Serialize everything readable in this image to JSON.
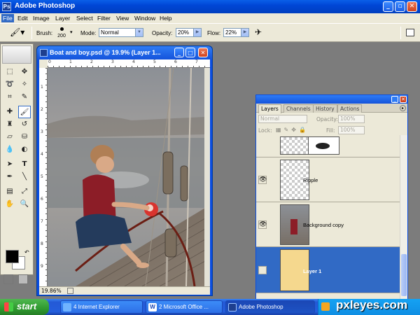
{
  "window": {
    "title": "Adobe Photoshop"
  },
  "menu": [
    "File",
    "Edit",
    "Image",
    "Layer",
    "Select",
    "Filter",
    "View",
    "Window",
    "Help"
  ],
  "options": {
    "brush_label": "Brush:",
    "brush_size": "200",
    "mode_label": "Mode:",
    "mode_value": "Normal",
    "opacity_label": "Opacity:",
    "opacity_value": "20%",
    "flow_label": "Flow:",
    "flow_value": "22%"
  },
  "document": {
    "title": "Boat and boy.psd @ 19.9% (Layer 1...",
    "zoom": "19.86%",
    "ruler_h": [
      "0",
      "1",
      "2",
      "3",
      "4",
      "5",
      "6",
      "7"
    ],
    "ruler_v": [
      "1",
      "2",
      "3",
      "4",
      "5",
      "6",
      "7",
      "8",
      "9"
    ]
  },
  "layers_palette": {
    "tabs": [
      "Layers",
      "Channels",
      "History",
      "Actions"
    ],
    "blend_mode": "Normal",
    "opacity_label": "Opacity:",
    "opacity_value": "100%",
    "lock_label": "Lock:",
    "fill_label": "Fill:",
    "fill_value": "100%",
    "layers": [
      {
        "name": "",
        "visible": false
      },
      {
        "name": "Ripple",
        "visible": true
      },
      {
        "name": "Background copy",
        "visible": true
      },
      {
        "name": "Layer 1",
        "visible": false,
        "selected": true
      }
    ]
  },
  "taskbar": {
    "start": "start",
    "items": [
      "4 Internet Explorer",
      "2 Microsoft Office ...",
      "Adobe Photoshop"
    ]
  },
  "watermark": "pxleyes.com",
  "colors": {
    "xp_blue": "#0046d6",
    "selected_layer": "#316ac5",
    "layer1_fill": "#f5d88e",
    "start_green": "#2f9a2f"
  }
}
